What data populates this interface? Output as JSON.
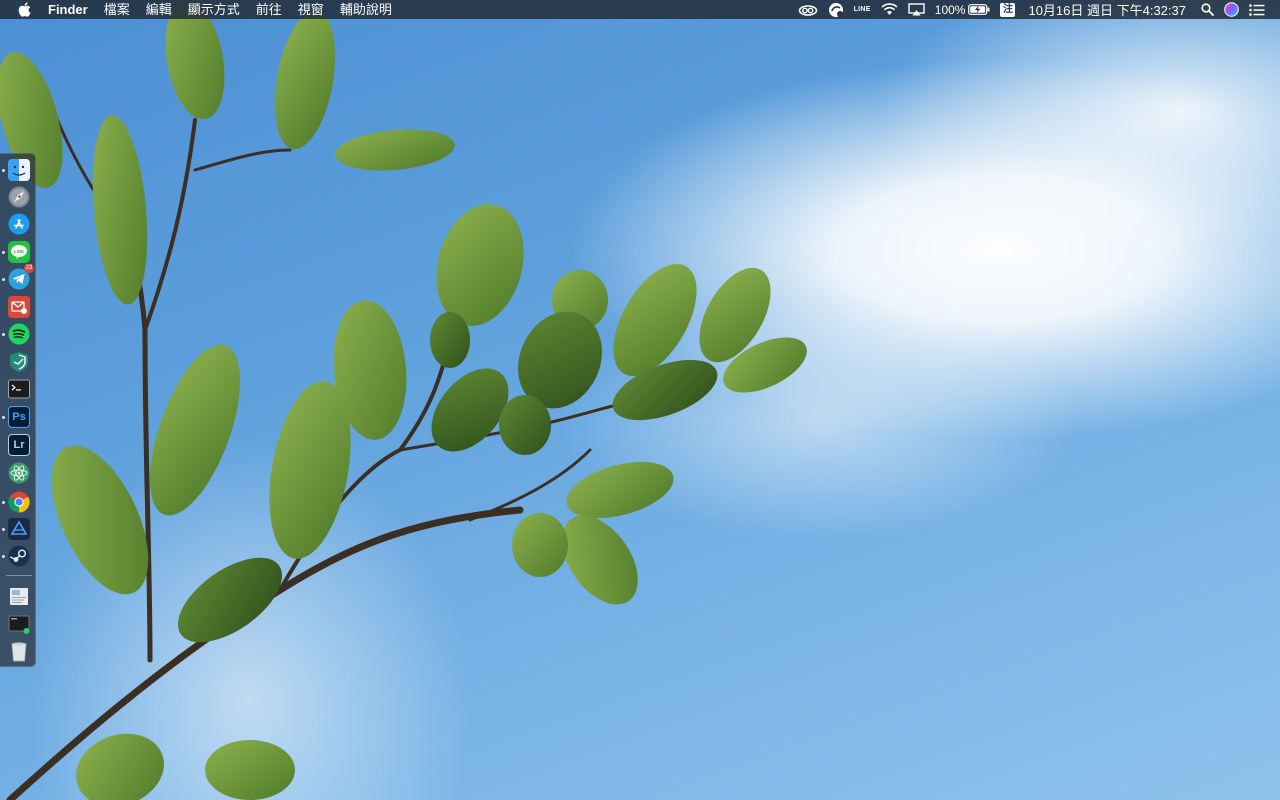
{
  "menubar": {
    "app_name": "Finder",
    "menus": [
      "檔案",
      "編輯",
      "顯示方式",
      "前往",
      "視窗",
      "輔助說明"
    ],
    "status": {
      "line_label": "LINE",
      "battery_percent": "100%",
      "input_method": "注",
      "clock": "10月16日 週日 下午4:32:37"
    },
    "icons": {
      "apple": "apple-logo-icon",
      "creative_cloud": "creative-cloud-icon",
      "sync_app": "sync-status-icon",
      "line": "line-icon",
      "wifi": "wifi-icon",
      "airplay": "airplay-icon",
      "battery": "battery-charging-icon",
      "spotlight": "spotlight-search-icon",
      "siri": "siri-icon",
      "notification_center": "notification-center-icon"
    }
  },
  "dock": {
    "apps": [
      {
        "name": "finder-icon",
        "running": true
      },
      {
        "name": "launchpad-icon",
        "running": false
      },
      {
        "name": "app-store-icon",
        "running": false
      },
      {
        "name": "line-app-icon",
        "running": true
      },
      {
        "name": "telegram-icon",
        "running": true,
        "badge": "23"
      },
      {
        "name": "mail-app-icon",
        "running": false
      },
      {
        "name": "spotify-icon",
        "running": true
      },
      {
        "name": "vpn-shield-icon",
        "running": false
      },
      {
        "name": "terminal-icon",
        "running": false
      },
      {
        "name": "photoshop-icon",
        "running": true,
        "label": "Ps"
      },
      {
        "name": "lightroom-icon",
        "running": false,
        "label": "Lr"
      },
      {
        "name": "atom-icon",
        "running": false
      },
      {
        "name": "chrome-icon",
        "running": true
      },
      {
        "name": "editor-app-icon",
        "running": true
      },
      {
        "name": "steam-icon",
        "running": true
      }
    ],
    "others": [
      {
        "name": "documents-stack-icon"
      },
      {
        "name": "downloads-stack-icon"
      },
      {
        "name": "trash-icon"
      }
    ]
  },
  "colors": {
    "menubar_bg": "#222c3a",
    "sky": "#5d9fdc",
    "leaf": "#6f9a3c",
    "branch": "#3b2e22"
  }
}
